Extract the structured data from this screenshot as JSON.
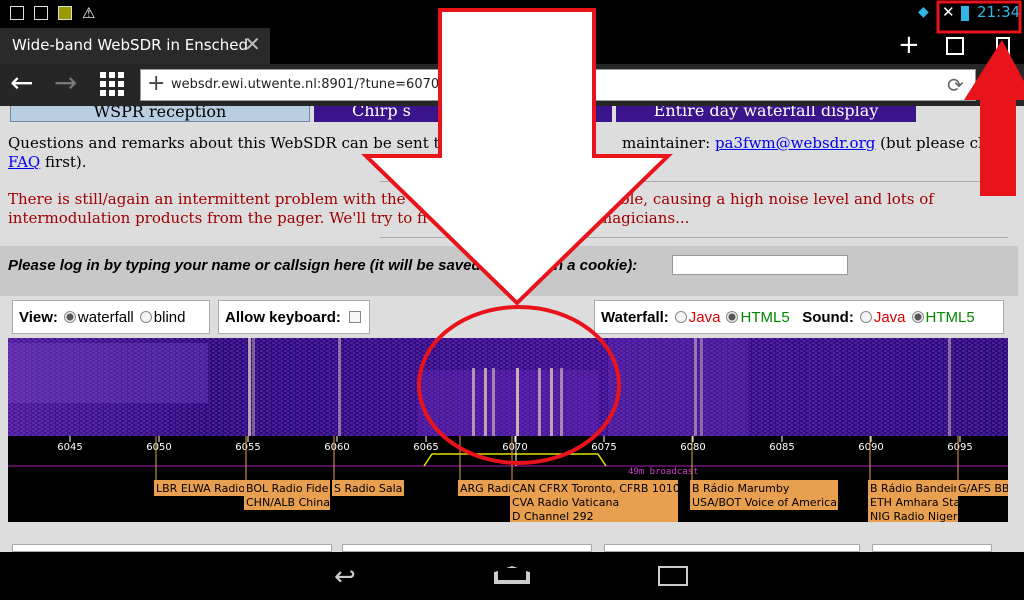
{
  "status": {
    "time": "21:34"
  },
  "tab": {
    "title": "Wide-band WebSDR in Ensched",
    "close": "✕"
  },
  "toolbar": {
    "url": "websdr.ewi.utwente.nl:8901/?tune=6070a",
    "back": "←",
    "forward": "→",
    "new_tab": "+",
    "plus": "+"
  },
  "page": {
    "banner_labels": [
      "WSPR reception",
      "Chirp s",
      "Entire day waterfall display"
    ],
    "contact_prefix": "Questions and remarks about this WebSDR can be sent to",
    "contact_mid": "maintainer:",
    "contact_email": "pa3fwm@websdr.org",
    "contact_suffix": "(but please check",
    "faq_link": "FAQ",
    "faq_suffix": "first).",
    "notice_line1_a": "There is still/again an intermittent problem with the",
    "notice_line1_b": "ble, causing a high noise level and lots of",
    "notice_line2_a": "intermodulation products from the pager. We'll try to fi",
    "notice_line2_b": "magicians...",
    "login_prompt_a": "Please log in by typing your name or callsign here (it will be saved",
    "login_prompt_b": "its in a cookie):"
  },
  "controls": {
    "view_label": "View:",
    "view_options": [
      "waterfall",
      "blind"
    ],
    "view_selected": "waterfall",
    "keyboard_label": "Allow keyboard:",
    "waterfall_label": "Waterfall:",
    "sound_label": "Sound:",
    "java": "Java",
    "html5": "HTML5"
  },
  "scale": {
    "ticks": [
      "6045",
      "6050",
      "6055",
      "6060",
      "6065",
      "6070",
      "6075",
      "6080",
      "6085",
      "6090",
      "6095"
    ],
    "band_label": "49m broadcast",
    "stations": [
      {
        "lines": [
          "LBR ELWA Radio"
        ]
      },
      {
        "lines": [
          "BOL Radio Fide",
          "CHN/ALB China"
        ]
      },
      {
        "lines": [
          "S Radio Sala"
        ]
      },
      {
        "lines": [
          "ARG Radi"
        ]
      },
      {
        "lines": [
          "CAN CFRX Toronto, CFRB 1010",
          "CVA Radio Vaticana",
          "D Channel 292"
        ]
      },
      {
        "lines": [
          "B Rádio Marumby",
          "USA/BOT Voice of America"
        ]
      },
      {
        "lines": [
          "B Rádio Bandeir",
          "ETH Amhara Sta",
          "NIG Radio Nigeri"
        ]
      },
      {
        "lines": [
          "G/AFS BBC"
        ]
      }
    ]
  },
  "colors": {
    "annotation": "#e8131b",
    "waterfall_bg": "#2a0a7a",
    "link": "#0000ee",
    "notice": "#a00000",
    "station_box": "#e8a050"
  }
}
